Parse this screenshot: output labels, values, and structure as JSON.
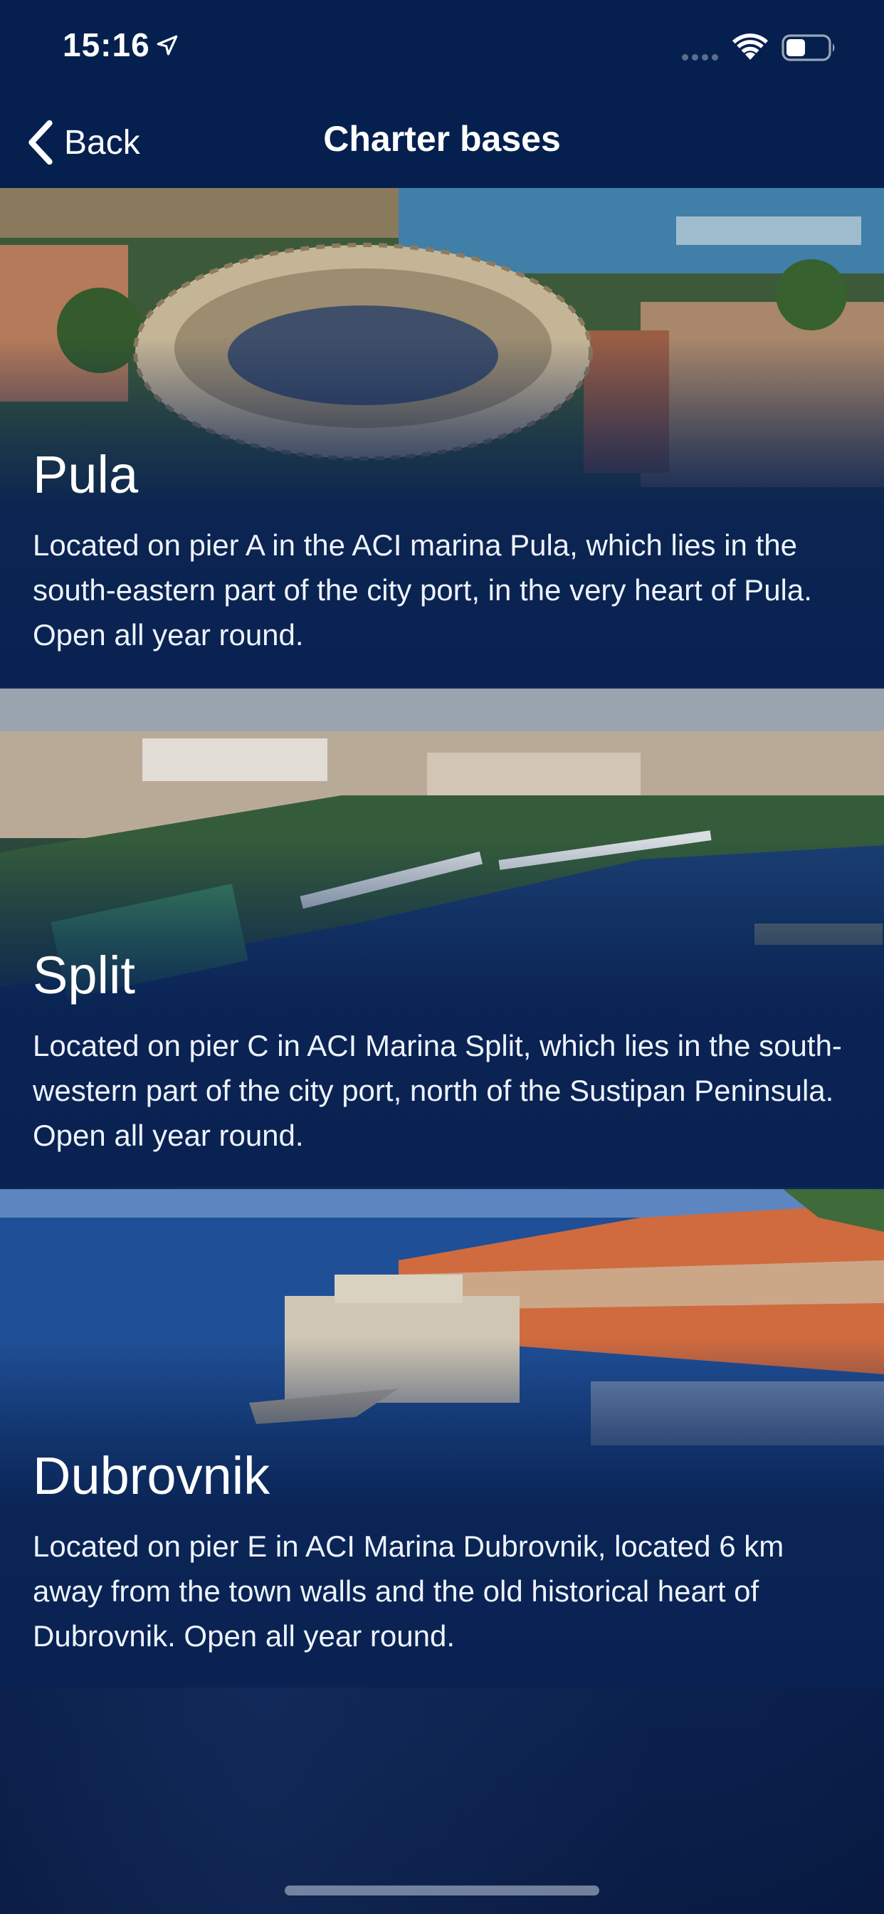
{
  "status_bar": {
    "time": "15:16",
    "icons": [
      "location-arrow-icon",
      "signal-icon",
      "wifi-icon",
      "battery-icon"
    ]
  },
  "nav": {
    "back_label": "Back",
    "title": "Charter bases"
  },
  "bases": [
    {
      "name": "Pula",
      "description": "Located on pier A in the ACI marina Pula, which lies in the south-eastern part of the city port, in the very heart of Pula. Open all year round."
    },
    {
      "name": "Split",
      "description": "Located on pier C in ACI Marina Split, which lies in the south-western part of the city port, north of the Sustipan Peninsula. Open all year round."
    },
    {
      "name": "Dubrovnik",
      "description": "Located on pier E in ACI Marina Dubrovnik, located 6 km away from the town walls and the old historical heart of Dubrovnik. Open all year round."
    }
  ],
  "colors": {
    "background": "#07204f",
    "header": "#05204f",
    "text": "#ffffff"
  }
}
